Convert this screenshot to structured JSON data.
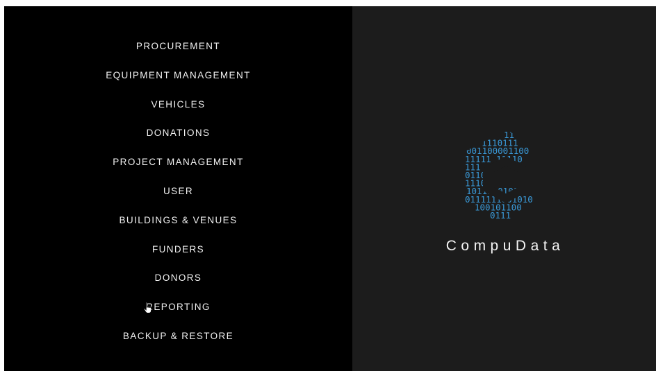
{
  "menu": {
    "items": [
      {
        "label": "PROCUREMENT"
      },
      {
        "label": "EQUIPMENT MANAGEMENT"
      },
      {
        "label": "VEHICLES"
      },
      {
        "label": "DONATIONS"
      },
      {
        "label": "PROJECT MANAGEMENT"
      },
      {
        "label": "USER"
      },
      {
        "label": "BUILDINGS & VENUES"
      },
      {
        "label": "FUNDERS"
      },
      {
        "label": "DONORS"
      },
      {
        "label": "REPORTING"
      },
      {
        "label": "BACKUP & RESTORE"
      }
    ]
  },
  "brand": {
    "name": "CompuData",
    "logo_icon": "binary-hexagon-c-logo",
    "logo_binary_rows": [
      "11",
      "1110111",
      "001100001100",
      "11111 11110",
      "111",
      "0110",
      "1110",
      "10111 0101",
      "0111111001010",
      "100101100",
      "0111"
    ]
  },
  "cursor": {
    "icon": "hand-pointer-icon"
  },
  "colors": {
    "menu_background": "#000000",
    "brand_background": "#1c1c1c",
    "menu_text": "#f2f2f2",
    "logo_digits": "#3a9ad9"
  }
}
